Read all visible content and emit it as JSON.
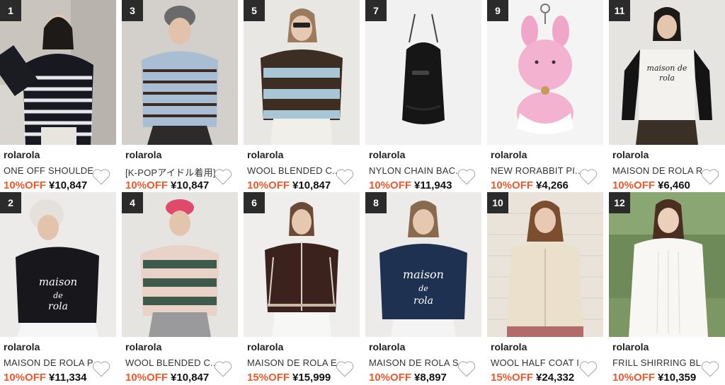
{
  "products": [
    {
      "rank": "1",
      "brand": "rolarola",
      "name": "ONE OFF SHOULDE...",
      "discount": "10%OFF",
      "price": "¥10,847",
      "scene": "stripe-cardigan"
    },
    {
      "rank": "2",
      "brand": "rolarola",
      "name": "MAISON DE ROLA P...",
      "discount": "10%OFF",
      "price": "¥11,334",
      "scene": "black-logo-knit"
    },
    {
      "rank": "3",
      "brand": "rolarola",
      "name": "[K-POPアイドル着用]...",
      "discount": "10%OFF",
      "price": "¥10,847",
      "scene": "blue-stripe-cardigan"
    },
    {
      "rank": "4",
      "brand": "rolarola",
      "name": "WOOL BLENDED C...",
      "discount": "10%OFF",
      "price": "¥10,847",
      "scene": "green-stripe-polo"
    },
    {
      "rank": "5",
      "brand": "rolarola",
      "name": "WOOL BLENDED C...",
      "discount": "10%OFF",
      "price": "¥10,847",
      "scene": "brown-stripe-polo"
    },
    {
      "rank": "6",
      "brand": "rolarola",
      "name": "MAISON DE ROLA E...",
      "discount": "15%OFF",
      "price": "¥15,999",
      "scene": "brown-zip-cardigan"
    },
    {
      "rank": "7",
      "brand": "rolarola",
      "name": "NYLON CHAIN BAC...",
      "discount": "10%OFF",
      "price": "¥11,943",
      "scene": "black-backpack"
    },
    {
      "rank": "8",
      "brand": "rolarola",
      "name": "MAISON DE ROLA S...",
      "discount": "10%OFF",
      "price": "¥8,897",
      "scene": "navy-logo-sweat"
    },
    {
      "rank": "9",
      "brand": "rolarola",
      "name": "NEW RORABBIT PI...",
      "discount": "10%OFF",
      "price": "¥4,266",
      "scene": "pink-rabbit-keyring"
    },
    {
      "rank": "10",
      "brand": "rolarola",
      "name": "WOOL HALF COAT I...",
      "discount": "15%OFF",
      "price": "¥24,332",
      "scene": "cream-half-coat"
    },
    {
      "rank": "11",
      "brand": "rolarola",
      "name": "MAISON DE ROLA R...",
      "discount": "10%OFF",
      "price": "¥6,460",
      "scene": "raglan-tee"
    },
    {
      "rank": "12",
      "brand": "rolarola",
      "name": "FRILL SHIRRING BL...",
      "discount": "10%OFF",
      "price": "¥10,359",
      "scene": "white-frill-blouse"
    }
  ],
  "colors": {
    "discount": "#f2572b",
    "rank_badge": "#2b2b2b",
    "heart": "#ffffff"
  },
  "icons": {
    "like": "heart-icon"
  }
}
